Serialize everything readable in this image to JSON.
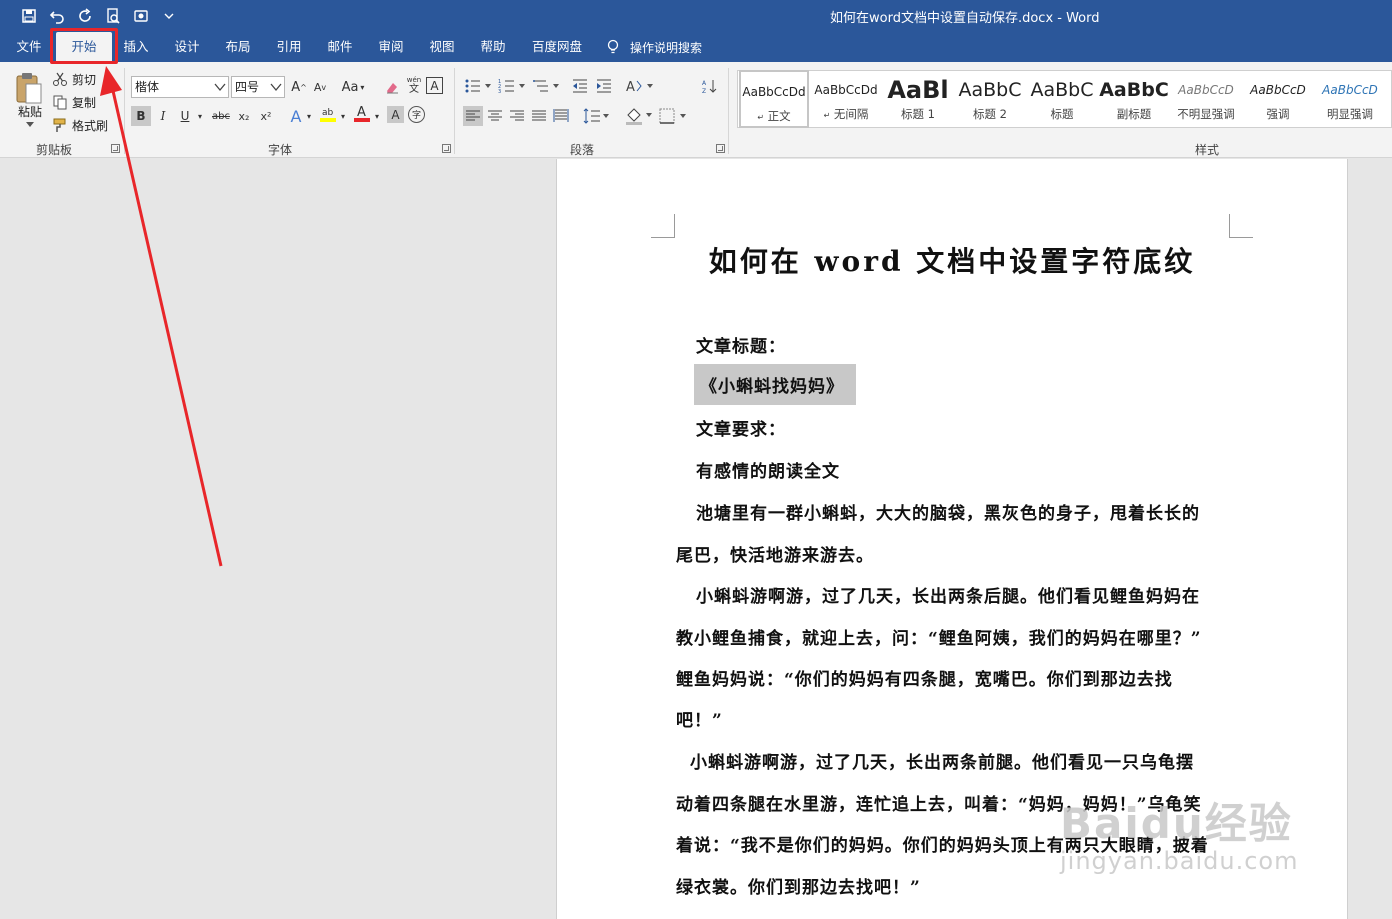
{
  "titlebar": {
    "document_title": "如何在word文档中设置自动保存.docx  -  Word",
    "qat_icons": [
      "save-icon",
      "undo-icon",
      "redo-icon",
      "print-preview-icon",
      "touch-mode-icon",
      "customize-qat-icon"
    ]
  },
  "tabs": [
    {
      "label": "文件"
    },
    {
      "label": "开始"
    },
    {
      "label": "插入"
    },
    {
      "label": "设计"
    },
    {
      "label": "布局"
    },
    {
      "label": "引用"
    },
    {
      "label": "邮件"
    },
    {
      "label": "审阅"
    },
    {
      "label": "视图"
    },
    {
      "label": "帮助"
    },
    {
      "label": "百度网盘"
    }
  ],
  "active_tab": "开始",
  "tell_me": {
    "label": "操作说明搜索",
    "icon": "lightbulb-icon"
  },
  "ribbon": {
    "clipboard": {
      "group_label": "剪贴板",
      "paste_label": "粘贴",
      "cut_label": "剪切",
      "copy_label": "复制",
      "format_painter_label": "格式刷"
    },
    "font": {
      "group_label": "字体",
      "font_name": "楷体",
      "font_size": "四号",
      "bold": "B",
      "italic": "I",
      "underline": "U",
      "strikethrough": "abc",
      "subscript": "x₂",
      "superscript": "x²",
      "change_case": "Aa",
      "font_color": "#e8262a",
      "highlight_color": "#ffff00"
    },
    "paragraph": {
      "group_label": "段落"
    },
    "styles": {
      "group_label": "样式",
      "items": [
        {
          "sample": "AaBbCcDd",
          "name": "正文",
          "prefix": "↵"
        },
        {
          "sample": "AaBbCcDd",
          "name": "无间隔",
          "prefix": "↵"
        },
        {
          "sample": "AaBl",
          "name": "标题 1"
        },
        {
          "sample": "AaBbC",
          "name": "标题 2"
        },
        {
          "sample": "AaBbC",
          "name": "标题"
        },
        {
          "sample": "AaBbC",
          "name": "副标题"
        },
        {
          "sample": "AaBbCcD",
          "name": "不明显强调"
        },
        {
          "sample": "AaBbCcD",
          "name": "强调"
        },
        {
          "sample": "AaBbCcD",
          "name": "明显强调"
        }
      ]
    }
  },
  "document": {
    "heading": "如何在 word 文档中设置字符底纹",
    "paragraphs": [
      "文章标题：",
      "《小蝌蚪找妈妈》",
      "文章要求：",
      "有感情的朗读全文",
      "池塘里有一群小蝌蚪，大大的脑袋，黑灰色的身子，甩着长长的",
      "尾巴，快活地游来游去。",
      "小蝌蚪游啊游，过了几天，长出两条后腿。他们看见鲤鱼妈妈在",
      "教小鲤鱼捕食，就迎上去，问：“鲤鱼阿姨，我们的妈妈在哪里？”",
      "鲤鱼妈妈说：“你们的妈妈有四条腿，宽嘴巴。你们到那边去找",
      "吧！”",
      "小蝌蚪游啊游，过了几天，长出两条前腿。他们看见一只乌龟摆",
      "动着四条腿在水里游，连忙追上去，叫着：“妈妈，妈妈！”乌龟笑",
      "着说：“我不是你们的妈妈。你们的妈妈头顶上有两只大眼睛，披着",
      "绿衣裳。你们到那边去找吧！”"
    ]
  },
  "annotation": {
    "color": "#e8262a"
  },
  "watermark": {
    "main": "Baidu经验",
    "sub": "jingyan.baidu.com"
  }
}
